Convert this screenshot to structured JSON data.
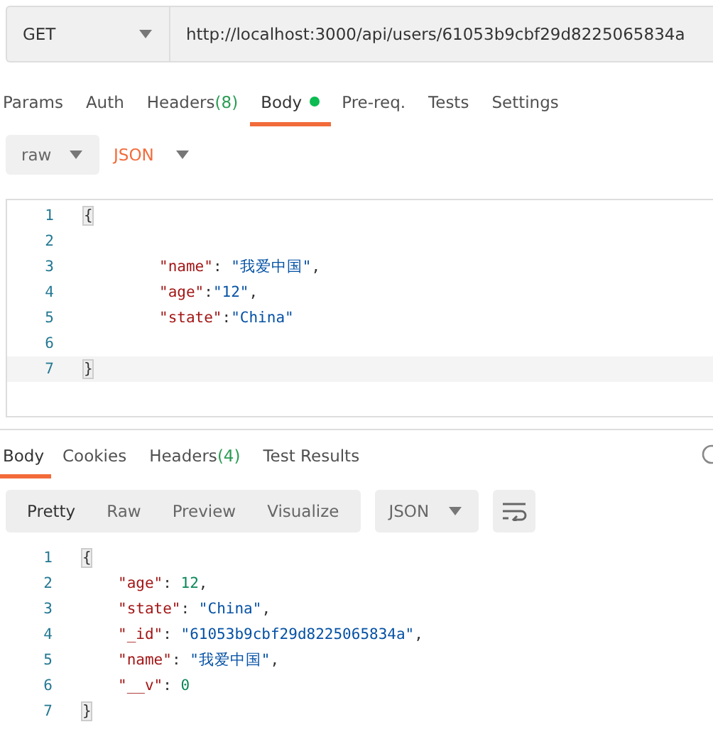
{
  "request": {
    "method": "GET",
    "url": "http://localhost:3000/api/users/61053b9cbf29d8225065834a"
  },
  "request_tabs": [
    {
      "label": "Params",
      "selected": false,
      "dot": false
    },
    {
      "label": "Auth",
      "selected": false,
      "dot": false
    },
    {
      "label": "Headers",
      "selected": false,
      "count": "(8)",
      "dot": false
    },
    {
      "label": "Body",
      "selected": true,
      "dot": true
    },
    {
      "label": "Pre-req.",
      "selected": false,
      "dot": false
    },
    {
      "label": "Tests",
      "selected": false,
      "dot": false
    },
    {
      "label": "Settings",
      "selected": false,
      "dot": false
    }
  ],
  "body_mode": {
    "type": "raw",
    "format": "JSON"
  },
  "request_editor": {
    "lines": [
      {
        "number": "1",
        "current": false,
        "tokens": [
          {
            "kind": "bracket",
            "text": "{"
          }
        ]
      },
      {
        "number": "2",
        "current": false
      },
      {
        "number": "3",
        "current": false,
        "tokens": [
          {
            "kind": "key",
            "text": "\"name\""
          },
          {
            "kind": "punct",
            "text": ": "
          },
          {
            "kind": "string",
            "text": "\"我爱中国\""
          },
          {
            "kind": "punct",
            "text": ","
          }
        ]
      },
      {
        "number": "4",
        "current": false,
        "tokens": [
          {
            "kind": "key",
            "text": "\"age\""
          },
          {
            "kind": "punct",
            "text": ":"
          },
          {
            "kind": "string",
            "text": "\"12\""
          },
          {
            "kind": "punct",
            "text": ","
          }
        ]
      },
      {
        "number": "5",
        "current": false,
        "tokens": [
          {
            "kind": "key",
            "text": "\"state\""
          },
          {
            "kind": "punct",
            "text": ":"
          },
          {
            "kind": "string",
            "text": "\"China\""
          }
        ]
      },
      {
        "number": "6",
        "current": false
      },
      {
        "number": "7",
        "current": true,
        "tokens": [
          {
            "kind": "bracket",
            "text": "}"
          }
        ]
      }
    ]
  },
  "response_tabs": [
    {
      "label": "Body",
      "selected": true
    },
    {
      "label": "Cookies",
      "selected": false
    },
    {
      "label": "Headers",
      "selected": false,
      "count": "(4)"
    },
    {
      "label": "Test Results",
      "selected": false
    }
  ],
  "view_modes": [
    {
      "label": "Pretty",
      "selected": true
    },
    {
      "label": "Raw",
      "selected": false
    },
    {
      "label": "Preview",
      "selected": false
    },
    {
      "label": "Visualize",
      "selected": false
    }
  ],
  "response_format": "JSON",
  "response_body": {
    "lines": [
      {
        "number": "1",
        "tokens": [
          {
            "kind": "bracket",
            "text": "{"
          }
        ]
      },
      {
        "number": "2",
        "tokens": [
          {
            "kind": "key",
            "text": "\"age\""
          },
          {
            "kind": "punct",
            "text": ": "
          },
          {
            "kind": "number",
            "text": "12"
          },
          {
            "kind": "punct",
            "text": ","
          }
        ]
      },
      {
        "number": "3",
        "tokens": [
          {
            "kind": "key",
            "text": "\"state\""
          },
          {
            "kind": "punct",
            "text": ": "
          },
          {
            "kind": "string",
            "text": "\"China\""
          },
          {
            "kind": "punct",
            "text": ","
          }
        ]
      },
      {
        "number": "4",
        "tokens": [
          {
            "kind": "key",
            "text": "\"_id\""
          },
          {
            "kind": "punct",
            "text": ": "
          },
          {
            "kind": "string",
            "text": "\"61053b9cbf29d8225065834a\""
          },
          {
            "kind": "punct",
            "text": ","
          }
        ]
      },
      {
        "number": "5",
        "tokens": [
          {
            "kind": "key",
            "text": "\"name\""
          },
          {
            "kind": "punct",
            "text": ": "
          },
          {
            "kind": "string",
            "text": "\"我爱中国\""
          },
          {
            "kind": "punct",
            "text": ","
          }
        ]
      },
      {
        "number": "6",
        "tokens": [
          {
            "kind": "key",
            "text": "\"__v\""
          },
          {
            "kind": "punct",
            "text": ": "
          },
          {
            "kind": "number",
            "text": "0"
          }
        ]
      },
      {
        "number": "7",
        "tokens": [
          {
            "kind": "bracket",
            "text": "}"
          }
        ]
      }
    ]
  }
}
